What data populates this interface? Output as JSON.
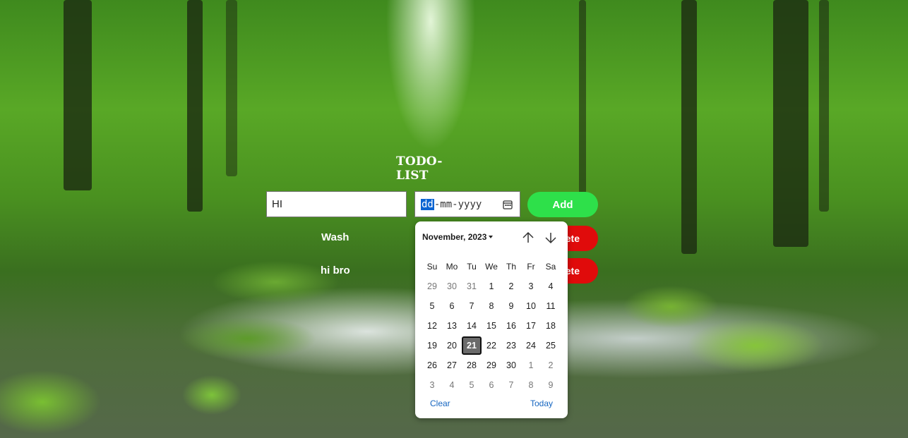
{
  "app": {
    "title": "TODO-LIST"
  },
  "form": {
    "task_value": "HI",
    "date_placeholder": {
      "day": "dd",
      "month": "mm",
      "year": "yyyy"
    },
    "add_label": "Add"
  },
  "todos": [
    {
      "name": "Wash",
      "delete_label": "ete"
    },
    {
      "name": "hi bro",
      "delete_label": "ete"
    }
  ],
  "datepicker": {
    "month_label": "November, 2023",
    "weekdays": [
      "Su",
      "Mo",
      "Tu",
      "We",
      "Th",
      "Fr",
      "Sa"
    ],
    "weeks": [
      [
        "29",
        "30",
        "31",
        "1",
        "2",
        "3",
        "4"
      ],
      [
        "5",
        "6",
        "7",
        "8",
        "9",
        "10",
        "11"
      ],
      [
        "12",
        "13",
        "14",
        "15",
        "16",
        "17",
        "18"
      ],
      [
        "19",
        "20",
        "21",
        "22",
        "23",
        "24",
        "25"
      ],
      [
        "26",
        "27",
        "28",
        "29",
        "30",
        "1",
        "2"
      ],
      [
        "3",
        "4",
        "5",
        "6",
        "7",
        "8",
        "9"
      ]
    ],
    "today": "21",
    "clear_label": "Clear",
    "today_label": "Today"
  },
  "colors": {
    "add": "#2ee04a",
    "delete": "#e00b0b",
    "link": "#1565c0",
    "selection": "#0b64d2"
  },
  "icons": [
    "calendar-icon",
    "arrow-up-icon",
    "arrow-down-icon",
    "caret-down-icon"
  ]
}
